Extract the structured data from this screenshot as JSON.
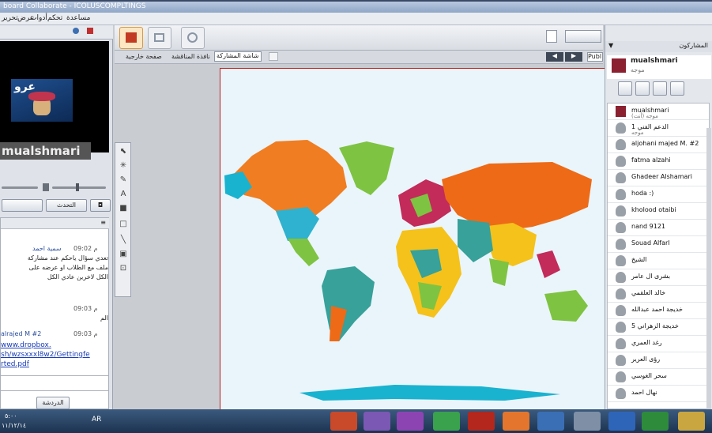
{
  "window": {
    "title": "board Collaborate - ICOLUSCOMPLTINGS"
  },
  "menu": [
    "مساعدة",
    "تحكم",
    "أدوات",
    "عرض",
    "تحرير",
    "ملف"
  ],
  "video": {
    "name": "mualshmari",
    "avatar_text": "عرو"
  },
  "left_buttons": {
    "talk": "التحدث"
  },
  "chat": {
    "messages": [
      {
        "time": "09:02 م",
        "author": "سمية احمد",
        "text": "تعدي سؤال ياحكم عند مشاركة"
      },
      {
        "time": "",
        "author": "",
        "text": "ملف مع الطلاب او عرضه على"
      },
      {
        "time": "",
        "author": "",
        "text": "الكل لاخرين عادي الكل"
      },
      {
        "time": "09:03 م",
        "author": "",
        "text": "الم"
      },
      {
        "time": "09:03 م",
        "author": "alrajed M #2",
        "text": ""
      }
    ],
    "link": [
      "www.dropbox.",
      "sh/wzsxxxl8w2/Gettingfe",
      "rted.pdf"
    ],
    "tabs": [
      "الدردشة",
      "المشاركون"
    ]
  },
  "stage": {
    "page_tabs": [
      "شاشة المشاركة",
      "نافذة المناقشة",
      "صفحة خارجية"
    ],
    "page_label": "Publ"
  },
  "participants": {
    "header": "المشاركون",
    "presenter": {
      "name": "mualshmari",
      "role": "موجه"
    },
    "list": [
      {
        "name": "mualshmari",
        "sub": "موجه (أنت)"
      },
      {
        "name": "الدعم الفني 1",
        "sub": "موجه"
      },
      {
        "name": "aljohani majed M. #2",
        "sub": ""
      },
      {
        "name": "fatma alzahi",
        "sub": ""
      },
      {
        "name": "Ghadeer Alshamari",
        "sub": ""
      },
      {
        "name": "hoda :)",
        "sub": ""
      },
      {
        "name": "kholood otaibi",
        "sub": ""
      },
      {
        "name": "nand 9121",
        "sub": ""
      },
      {
        "name": "Souad Alfarl",
        "sub": ""
      },
      {
        "name": "الشيخ",
        "sub": ""
      },
      {
        "name": "بشرى ال عامر",
        "sub": ""
      },
      {
        "name": "خالد العلقمي",
        "sub": ""
      },
      {
        "name": "خديجة احمد عبدالله",
        "sub": ""
      },
      {
        "name": "خديجة الزهراني 5",
        "sub": ""
      },
      {
        "name": "رغد العمري",
        "sub": ""
      },
      {
        "name": "رؤى العرير",
        "sub": ""
      },
      {
        "name": "سحر الغوسي",
        "sub": ""
      },
      {
        "name": "نهال احمد",
        "sub": ""
      }
    ]
  },
  "taskbar": {
    "lang": "AR",
    "time": "٥:٠٠",
    "date": "١١/١٢/١٤"
  },
  "colors": {
    "ocean": "#e8f4fb",
    "north_america": "#f07d21",
    "south_america": "#37a19a",
    "europe": "#c22b5a",
    "asia": "#ee6a16",
    "africa": "#f5c21b",
    "oceania": "#7fc342",
    "greenland": "#7fc342"
  }
}
